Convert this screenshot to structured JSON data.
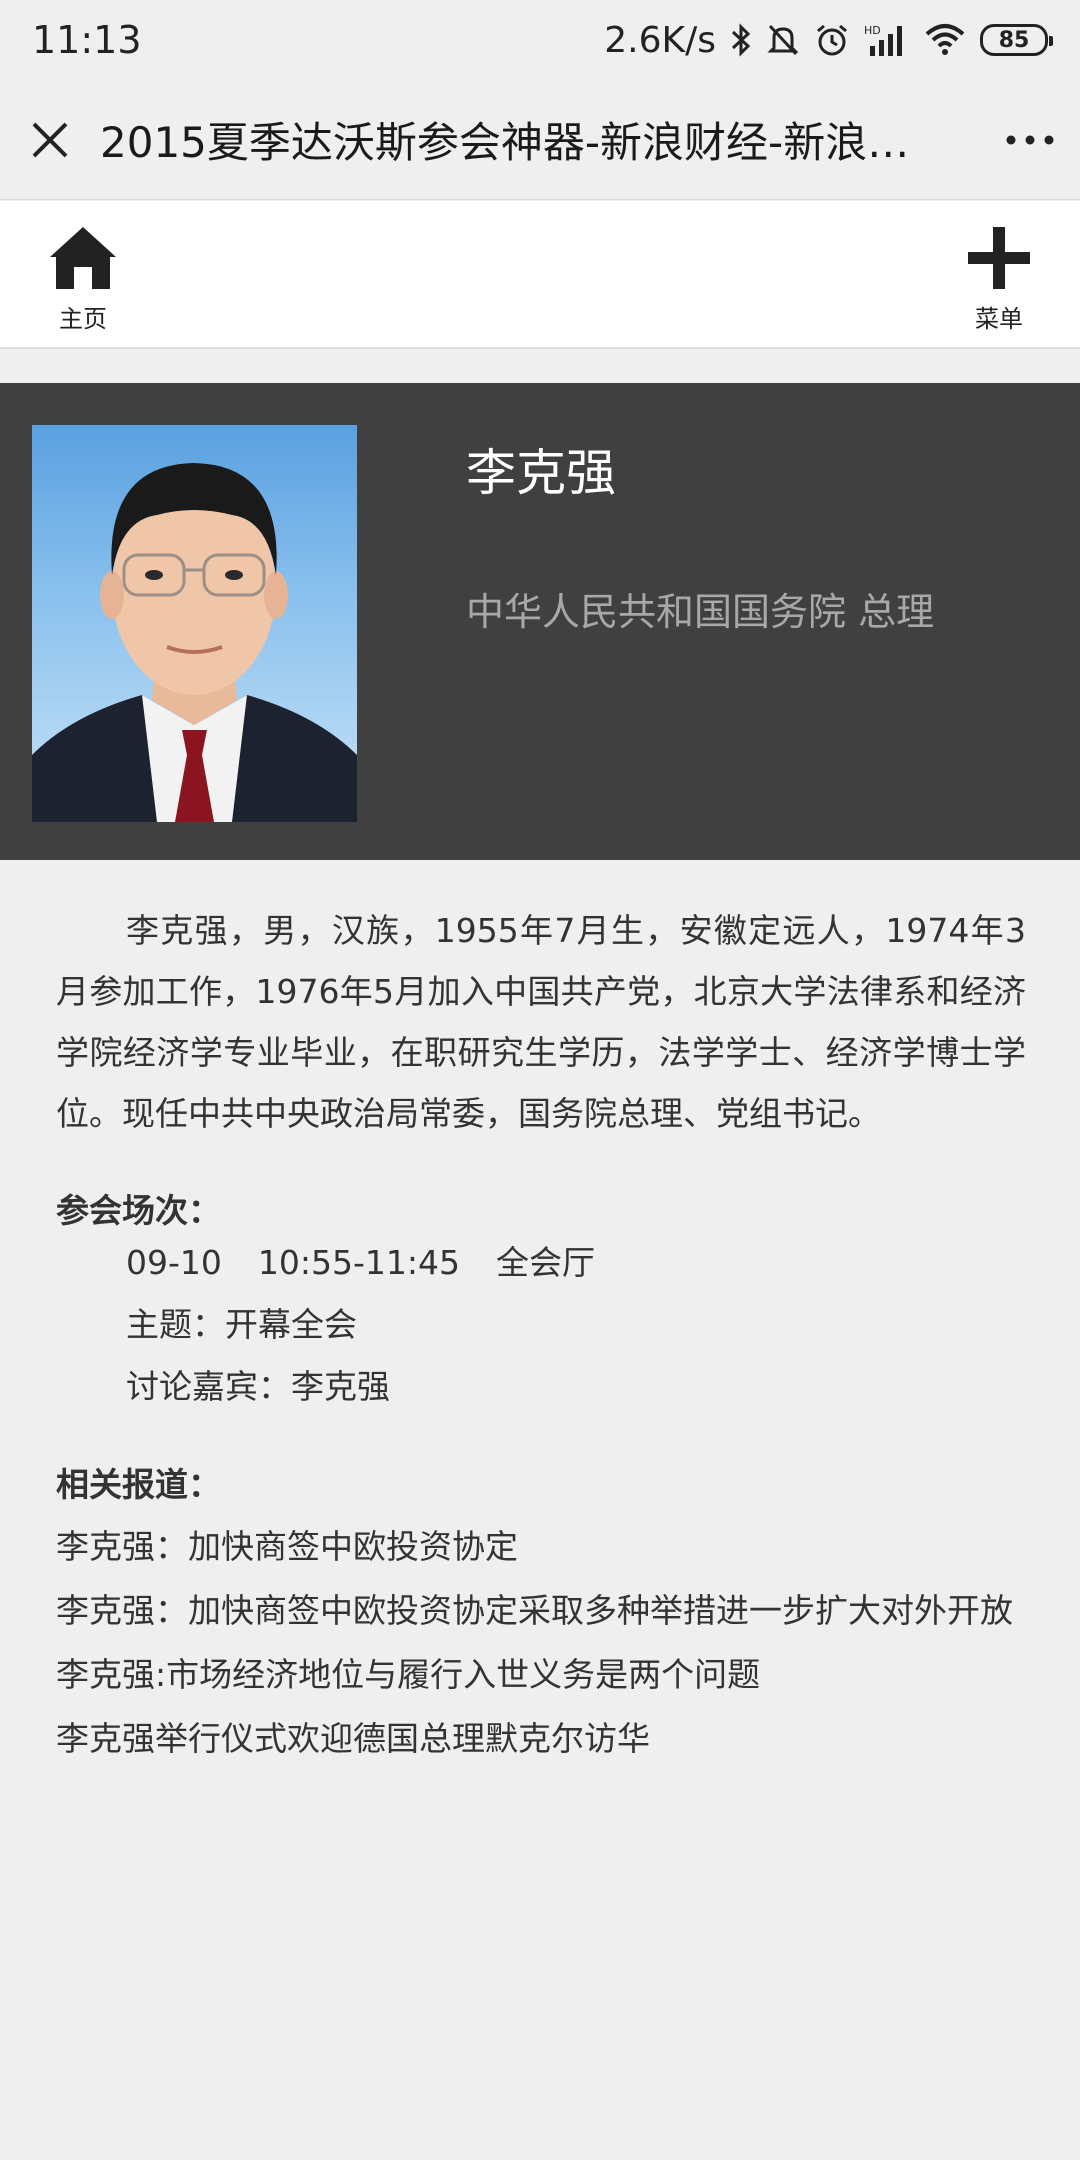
{
  "status_bar": {
    "time": "11:13",
    "speed": "2.6K/s",
    "battery": "85",
    "icons": [
      "bluetooth-icon",
      "mute-bell-icon",
      "alarm-icon",
      "hd-signal-icon",
      "wifi-icon",
      "battery-icon"
    ]
  },
  "title_bar": {
    "title": "2015夏季达沃斯参会神器-新浪财经-新浪…"
  },
  "nav": {
    "home_label": "主页",
    "menu_label": "菜单"
  },
  "profile": {
    "name": "李克强",
    "position": "中华人民共和国国务院 总理"
  },
  "bio": "李克强，男，汉族，1955年7月生，安徽定远人，1974年3月参加工作，1976年5月加入中国共产党，北京大学法律系和经济学院经济学专业毕业，在职研究生学历，法学学士、经济学博士学位。现任中共中央政治局常委，国务院总理、党组书记。",
  "session": {
    "heading": "参会场次：",
    "date": "09-10",
    "time": "10:55-11:45",
    "venue": "全会厅",
    "topic": "主题：开幕全会",
    "guests": "讨论嘉宾：李克强"
  },
  "related": {
    "heading": "相关报道：",
    "links": [
      "李克强：加快商签中欧投资协定",
      "李克强：加快商签中欧投资协定采取多种举措进一步扩大对外开放",
      "李克强:市场经济地位与履行入世义务是两个问题",
      "李克强举行仪式欢迎德国总理默克尔访华"
    ]
  },
  "colors": {
    "page_bg": "#efefef",
    "header_bg": "#404040",
    "name_color": "#ffffff",
    "position_color": "#a8a8a8"
  }
}
